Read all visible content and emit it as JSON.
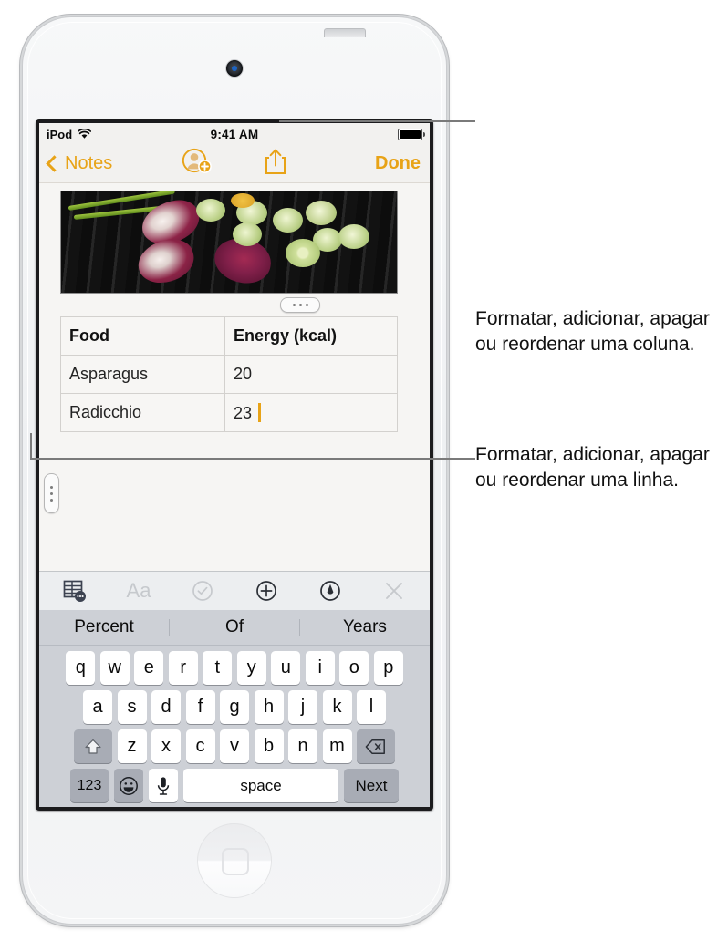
{
  "device": {
    "model": "iPod touch"
  },
  "status_bar": {
    "carrier": "iPod",
    "wifi_icon": "wifi-icon",
    "time": "9:41 AM",
    "battery_icon": "battery-full-icon"
  },
  "nav_bar": {
    "back_label": "Notes",
    "back_icon": "chevron-left-icon",
    "add_person_icon": "add-person-icon",
    "share_icon": "share-icon",
    "done_label": "Done"
  },
  "note": {
    "photo_alt": "grilled-vegetables-photo",
    "column_handle_icon": "column-handle-dots-icon",
    "row_handle_icon": "row-handle-dots-icon",
    "table": {
      "headers": [
        "Food",
        "Energy (kcal)"
      ],
      "rows": [
        [
          "Asparagus",
          "20"
        ],
        [
          "Radicchio",
          "23"
        ]
      ],
      "editing_cell": {
        "row": 1,
        "col": 1,
        "caret": true
      }
    }
  },
  "format_toolbar": {
    "items": [
      {
        "name": "table-options-icon",
        "label": "Table",
        "state": "active"
      },
      {
        "name": "text-format-icon",
        "label": "Aa",
        "state": "disabled"
      },
      {
        "name": "checklist-icon",
        "label": "Checklist",
        "state": "disabled"
      },
      {
        "name": "add-icon",
        "label": "Add",
        "state": "active"
      },
      {
        "name": "markup-pen-icon",
        "label": "Markup",
        "state": "active"
      },
      {
        "name": "close-icon",
        "label": "Close",
        "state": "disabled"
      }
    ]
  },
  "keyboard": {
    "predictive": [
      "Percent",
      "Of",
      "Years"
    ],
    "row1": [
      "q",
      "w",
      "e",
      "r",
      "t",
      "y",
      "u",
      "i",
      "o",
      "p"
    ],
    "row2": [
      "a",
      "s",
      "d",
      "f",
      "g",
      "h",
      "j",
      "k",
      "l"
    ],
    "row3": [
      "z",
      "x",
      "c",
      "v",
      "b",
      "n",
      "m"
    ],
    "shift_icon": "shift-arrow-icon",
    "delete_icon": "delete-backspace-icon",
    "numbers_label": "123",
    "emoji_icon": "emoji-smiley-icon",
    "dictation_icon": "microphone-icon",
    "space_label": "space",
    "return_label": "Next"
  },
  "callouts": [
    {
      "name": "column-callout",
      "text": "Formatar, adicionar, apagar ou reordenar uma coluna."
    },
    {
      "name": "row-callout",
      "text": "Formatar, adicionar, apagar ou reordenar uma linha."
    }
  ],
  "colors": {
    "accent": "#e8a317",
    "toolbar_active": "#3c4250",
    "toolbar_disabled": "#c6c9cd"
  }
}
